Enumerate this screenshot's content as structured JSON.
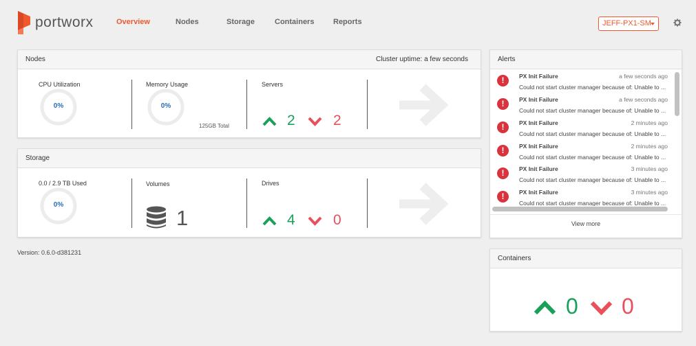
{
  "brand": {
    "name": "portworx",
    "color": "#f0582e"
  },
  "nav": {
    "items": [
      {
        "label": "Overview",
        "active": true
      },
      {
        "label": "Nodes",
        "active": false
      },
      {
        "label": "Storage",
        "active": false
      },
      {
        "label": "Containers",
        "active": false
      },
      {
        "label": "Reports",
        "active": false
      }
    ]
  },
  "cluster": {
    "selected": "JEFF-PX1-SM"
  },
  "nodes_panel": {
    "title": "Nodes",
    "uptime": "Cluster uptime: a few seconds",
    "cpu": {
      "label": "CPU Utilization",
      "value": "0%"
    },
    "memory": {
      "label": "Memory Usage",
      "value": "0%",
      "total": "125GB Total"
    },
    "servers": {
      "label": "Servers",
      "up": "2",
      "down": "2"
    }
  },
  "storage_panel": {
    "title": "Storage",
    "used": {
      "label": "0.0 / 2.9 TB Used",
      "value": "0%"
    },
    "volumes": {
      "label": "Volumes",
      "count": "1"
    },
    "drives": {
      "label": "Drives",
      "up": "4",
      "down": "0"
    }
  },
  "alerts_panel": {
    "title": "Alerts",
    "items": [
      {
        "title": "PX Init Failure",
        "time": "a few seconds ago",
        "message": "Could not start cluster manager because of: Unable to ..."
      },
      {
        "title": "PX Init Failure",
        "time": "a few seconds ago",
        "message": "Could not start cluster manager because of: Unable to ..."
      },
      {
        "title": "PX Init Failure",
        "time": "2 minutes ago",
        "message": "Could not start cluster manager because of: Unable to ..."
      },
      {
        "title": "PX Init Failure",
        "time": "2 minutes ago",
        "message": "Could not start cluster manager because of: Unable to ..."
      },
      {
        "title": "PX Init Failure",
        "time": "3 minutes ago",
        "message": "Could not start cluster manager because of: Unable to ..."
      },
      {
        "title": "PX Init Failure",
        "time": "3 minutes ago",
        "message": "Could not start cluster manager because of: Unable to ..."
      }
    ],
    "view_more": "View more"
  },
  "containers_panel": {
    "title": "Containers",
    "up": "0",
    "down": "0"
  },
  "version": "Version: 0.6.0-d381231",
  "colors": {
    "up": "#1ba05a",
    "down": "#e9505a",
    "accent": "#f0582e",
    "percent": "#2a6db5",
    "alert": "#d9343d"
  }
}
